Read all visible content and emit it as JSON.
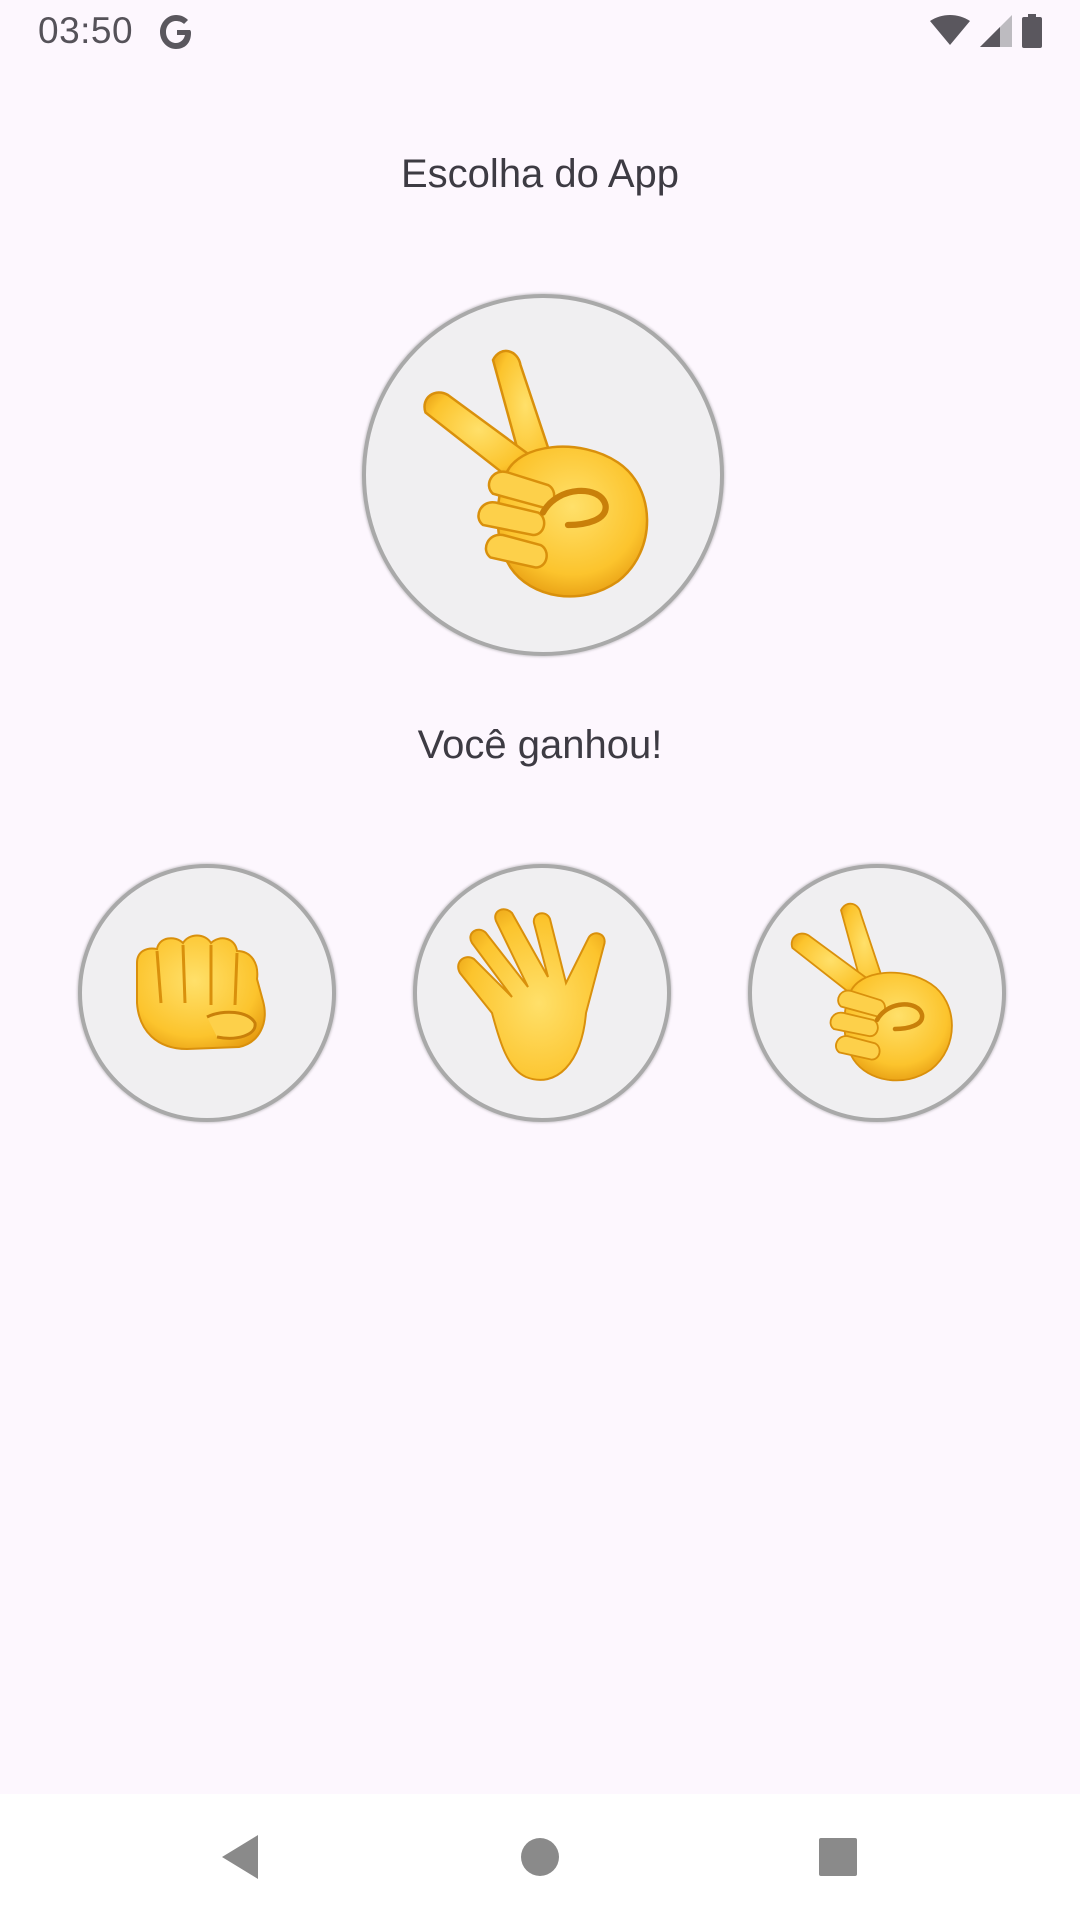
{
  "status_bar": {
    "time": "03:50",
    "icons": [
      "google-g-icon",
      "wifi-icon",
      "signal-icon",
      "battery-icon"
    ]
  },
  "title": "Escolha do App",
  "app_choice": {
    "icon": "scissors-hand-icon"
  },
  "result": "Você ganhou!",
  "options": [
    {
      "name": "rock",
      "icon": "fist-icon"
    },
    {
      "name": "paper",
      "icon": "open-hand-icon"
    },
    {
      "name": "scissors",
      "icon": "victory-hand-icon"
    }
  ],
  "colors": {
    "background": "#fdf7fe",
    "text": "#3d3b43",
    "circle_fill": "#f0eff1",
    "circle_border": "#a9a9a9",
    "emoji_yellow": "#fcc42d",
    "nav_icons": "#8a8a8a"
  },
  "nav_bar": {
    "buttons": [
      "back-icon",
      "home-icon",
      "recents-icon"
    ]
  }
}
